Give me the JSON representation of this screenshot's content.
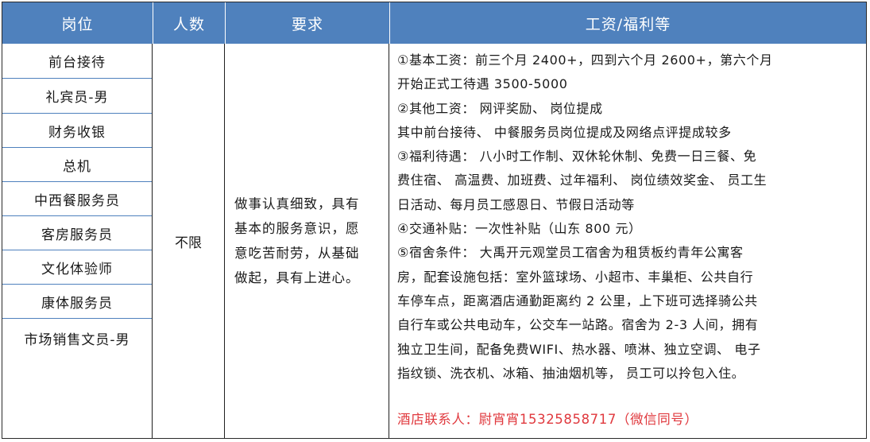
{
  "headers": [
    "岗位",
    "人数",
    "要求",
    "工资/福利等"
  ],
  "positions": [
    "前台接待",
    "礼宾员-男",
    "财务收银",
    "总机",
    "中西餐服务员",
    "客房服务员",
    "文化体验师",
    "康体服务员",
    "市场销售文员-男"
  ],
  "count": "不限",
  "requirements": [
    "做事认真细致，具有",
    "基本的服务意识，愿",
    "意吃苦耐劳，从基础",
    "做起，具有上进心。"
  ],
  "salary_lines": [
    "①基本工资：前三个月 2400+，四到六个月 2600+，第六个月",
    "开始正式工待遇 3500-5000",
    "②其他工资： 网评奖励、 岗位提成",
    "其中前台接待、 中餐服务员岗位提成及网络点评提成较多",
    "③福利待遇： 八小时工作制、双休轮休制、免费一日三餐、免",
    "费住宿、 高温费、加班费、过年福利、 岗位绩效奖金、 员工生",
    "日活动、每月员工感恩日、节假日活动等",
    "④交通补贴：一次性补贴（山东 800 元）",
    "⑤宿舍条件： 大禹开元观堂员工宿舍为租赁板约青年公寓客",
    "房，配套设施包括：室外篮球场、小超市、丰巢柜、公共自行",
    "车停车点，距离酒店通勤距离约 2 公里，上下班可选择骑公共",
    "自行车或公共电动车，公交车一站路。宿舍为 2-3 人间，拥有",
    "独立卫生间，配备免费WIFI、热水器、喷淋、独立空调、 电子",
    "指纹锁、洗衣机、冰箱、抽油烟机等， 员工可以拎包入住。"
  ],
  "contact": "酒店联系人：尉宵宵15325858717（微信同号）",
  "colors": {
    "header_bg": "#4f81bd",
    "contact": "#e0393e"
  }
}
